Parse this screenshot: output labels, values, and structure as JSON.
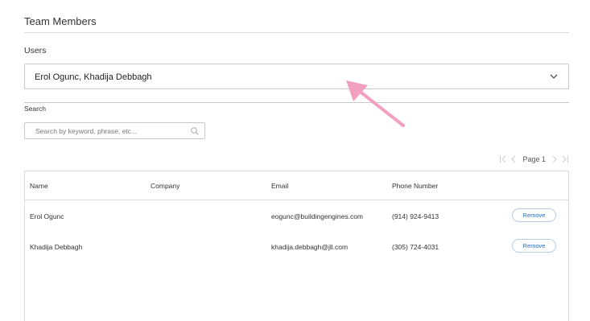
{
  "section": {
    "title": "Team Members"
  },
  "users": {
    "label": "Users",
    "selected": "Erol Ogunc, Khadija Debbagh"
  },
  "search": {
    "label": "Search",
    "placeholder": "Search by keyword, phrase, etc..."
  },
  "pagination": {
    "page_label": "Page 1"
  },
  "table": {
    "columns": [
      "Name",
      "Company",
      "Email",
      "Phone Number"
    ],
    "rows": [
      {
        "name": "Erol Ogunc",
        "company": "",
        "email": "eogunc@buildingengines.com",
        "phone": "(914) 924-9413",
        "action": "Remove"
      },
      {
        "name": "Khadija Debbagh",
        "company": "",
        "email": "khadija.debbagh@jll.com",
        "phone": "(305) 724-4031",
        "action": "Remove"
      }
    ]
  },
  "annotation": {
    "color": "#f2a0bf",
    "icon": "arrow-icon"
  }
}
